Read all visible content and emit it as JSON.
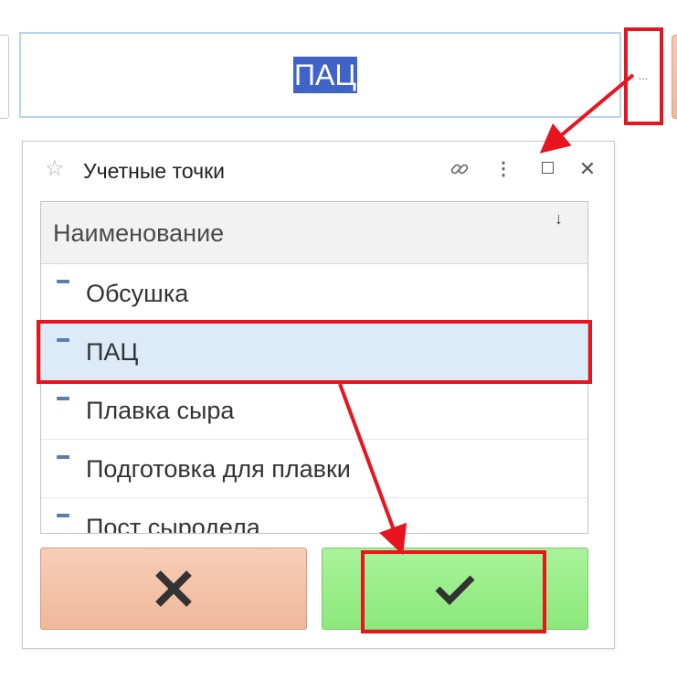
{
  "field": {
    "value": "ПАЦ",
    "select_button_label": "..."
  },
  "popup": {
    "title": "Учетные точки",
    "column_header": "Наименование",
    "sort_indicator": "↓",
    "rows": [
      {
        "label": "Обсушка",
        "selected": false
      },
      {
        "label": "ПАЦ",
        "selected": true
      },
      {
        "label": "Плавка сыра",
        "selected": false
      },
      {
        "label": "Подготовка для плавки",
        "selected": false
      },
      {
        "label": "Пост сыродела",
        "selected": false
      }
    ],
    "cancel_icon": "close-x-icon",
    "ok_icon": "checkmark-icon"
  },
  "colors": {
    "selection": "#3f63c6",
    "selected_row": "#dcebf8",
    "cancel_button": "#f4c2aa",
    "ok_button": "#98ee87",
    "annotation": "#e8141e"
  }
}
